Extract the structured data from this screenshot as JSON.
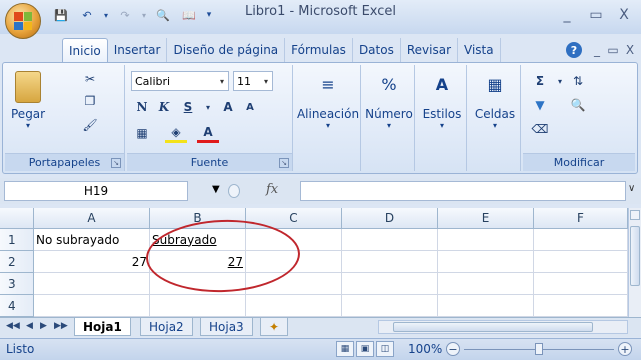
{
  "window": {
    "title": "Libro1 - Microsoft Excel",
    "minimize": "_",
    "maximize": "▭",
    "close": "X"
  },
  "ribbon_tabs": [
    "Inicio",
    "Insertar",
    "Diseño de página",
    "Fórmulas",
    "Datos",
    "Revisar",
    "Vista"
  ],
  "ribbon": {
    "portapapeles": {
      "label": "Portapapeles",
      "paste": "Pegar"
    },
    "fuente": {
      "label": "Fuente",
      "font_name": "Calibri",
      "font_size": "11",
      "bold": "N",
      "italic": "K",
      "underline": "S",
      "grow": "A",
      "shrink": "A",
      "font_color": "A"
    },
    "alineacion": {
      "label": "Alineación"
    },
    "numero": {
      "label": "Número",
      "icon_text": "%"
    },
    "estilos": {
      "label": "Estilos"
    },
    "celdas": {
      "label": "Celdas"
    },
    "modificar": {
      "label": "Modificar",
      "sum": "Σ"
    }
  },
  "formula_bar": {
    "name_box": "H19",
    "fx": "fx",
    "formula": ""
  },
  "grid": {
    "columns": [
      "A",
      "B",
      "C",
      "D",
      "E",
      "F"
    ],
    "rows": [
      "1",
      "2",
      "3",
      "4"
    ],
    "cells": {
      "A1": "No subrayado",
      "B1": "Subrayado",
      "A2": "27",
      "B2": "27"
    }
  },
  "sheets": [
    "Hoja1",
    "Hoja2",
    "Hoja3"
  ],
  "status": {
    "text": "Listo",
    "zoom": "100%"
  },
  "colors": {
    "annotation": "#c0272d",
    "accent": "#15428b"
  }
}
